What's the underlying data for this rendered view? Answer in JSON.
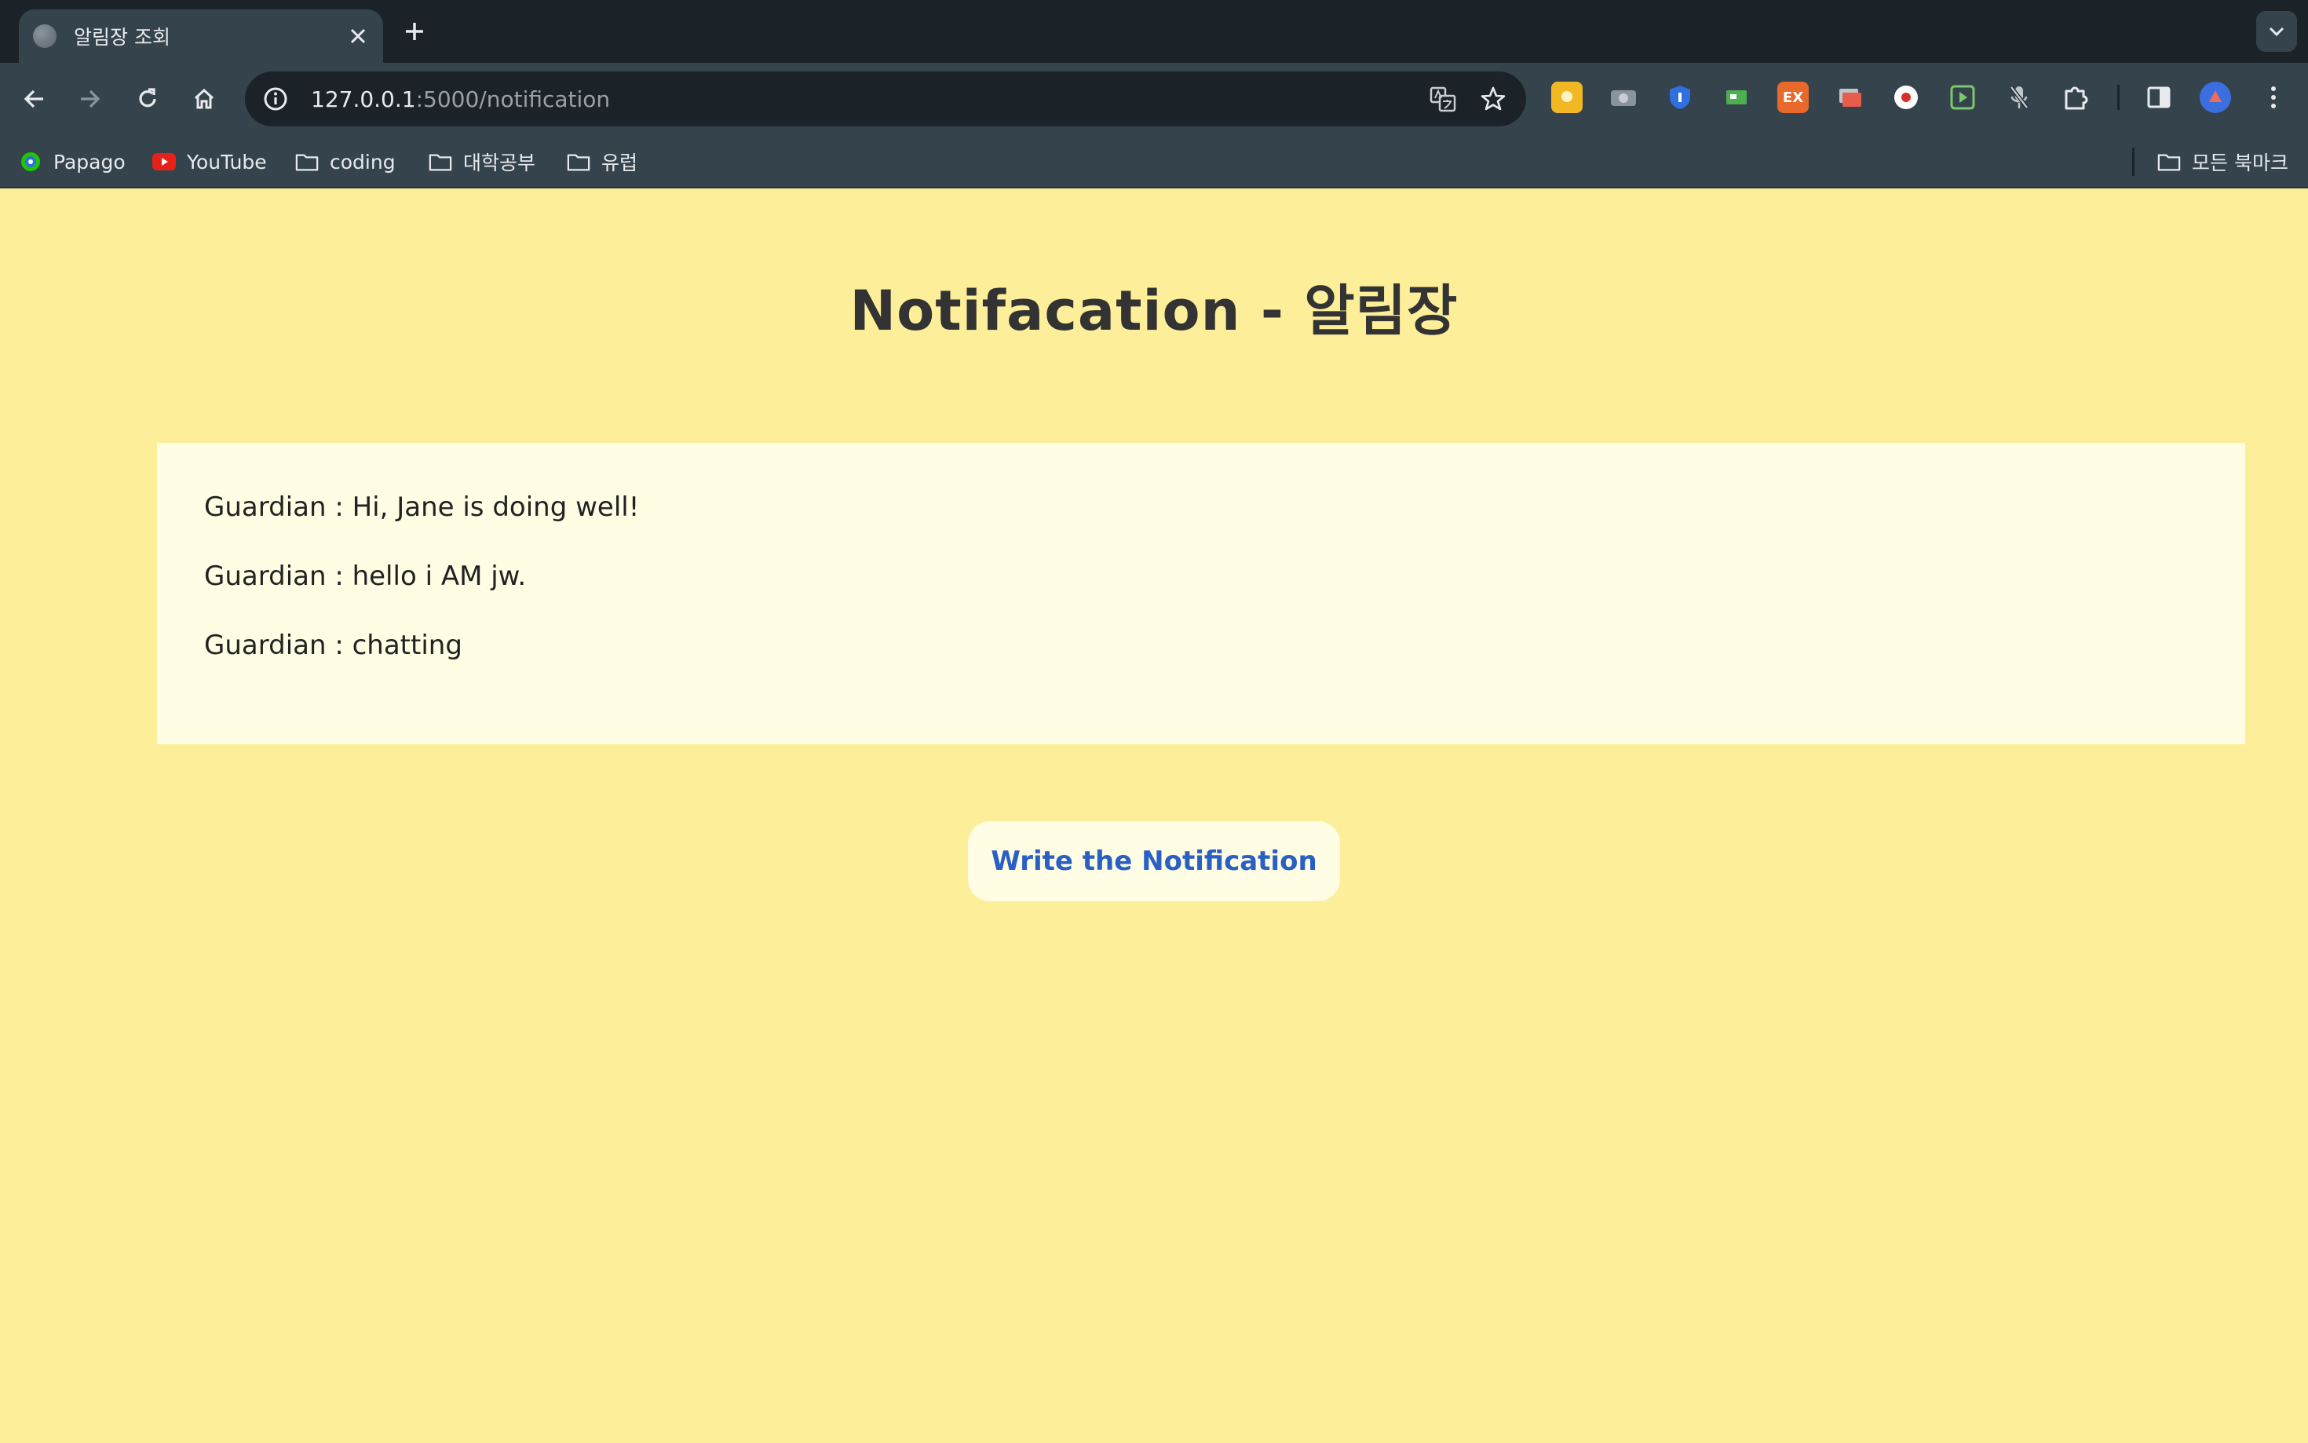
{
  "browser": {
    "tab_title": "알림장 조회",
    "url_host": "127.0.0.1",
    "url_path": ":5000/notification",
    "bookmarks": [
      "Papago",
      "YouTube",
      "coding",
      "대학공부",
      "유럽"
    ],
    "all_bookmarks_label": "모든 북마크",
    "extensions": [
      {
        "name": "note-extension",
        "color": "#f2b824"
      },
      {
        "name": "camera-extension",
        "color": "#8a949c"
      },
      {
        "name": "password-manager-extension",
        "color": "#2f6fe0"
      },
      {
        "name": "screen-extension",
        "color": "#4caf50"
      },
      {
        "name": "ex-extension",
        "color": "#e8692c",
        "label": "EX"
      },
      {
        "name": "cards-extension",
        "color": "#c0c5ca"
      },
      {
        "name": "record-extension",
        "color": "#ffffff"
      },
      {
        "name": "player-extension",
        "color": "#7cc96c"
      },
      {
        "name": "mic-off-extension",
        "color": "#c0c5ca"
      }
    ]
  },
  "page": {
    "title": "Notifacation - 알림장",
    "messages": [
      "Guardian : Hi, Jane is doing well!",
      "Guardian : hello i AM jw.",
      "Guardian : chatting"
    ],
    "write_button_label": "Write the Notification"
  }
}
